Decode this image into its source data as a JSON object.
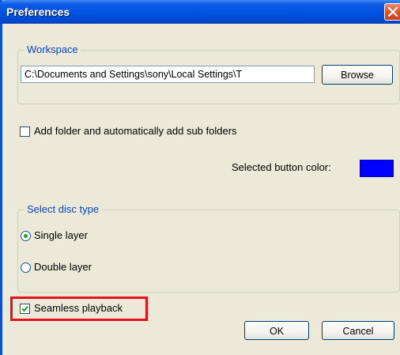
{
  "window": {
    "title": "Preferences"
  },
  "workspace": {
    "legend": "Workspace",
    "path_value": "C:\\Documents and Settings\\sony\\Local Settings\\T",
    "browse_label": "Browse"
  },
  "options": {
    "add_folder_label": "Add folder and automatically add sub folders",
    "add_folder_checked": false,
    "button_color_label": "Selected button color:",
    "button_color": "#0000ff"
  },
  "disc_type": {
    "legend": "Select disc type",
    "single_label": "Single layer",
    "double_label": "Double layer",
    "selected": "Single layer"
  },
  "seamless": {
    "label": "Seamless playback",
    "checked": true
  },
  "footer": {
    "ok_label": "OK",
    "cancel_label": "Cancel"
  },
  "colors": {
    "title_bar": "#0054e3",
    "legend_text": "#0046d5",
    "highlight": "#e5101a",
    "checkmark": "#21a121"
  }
}
